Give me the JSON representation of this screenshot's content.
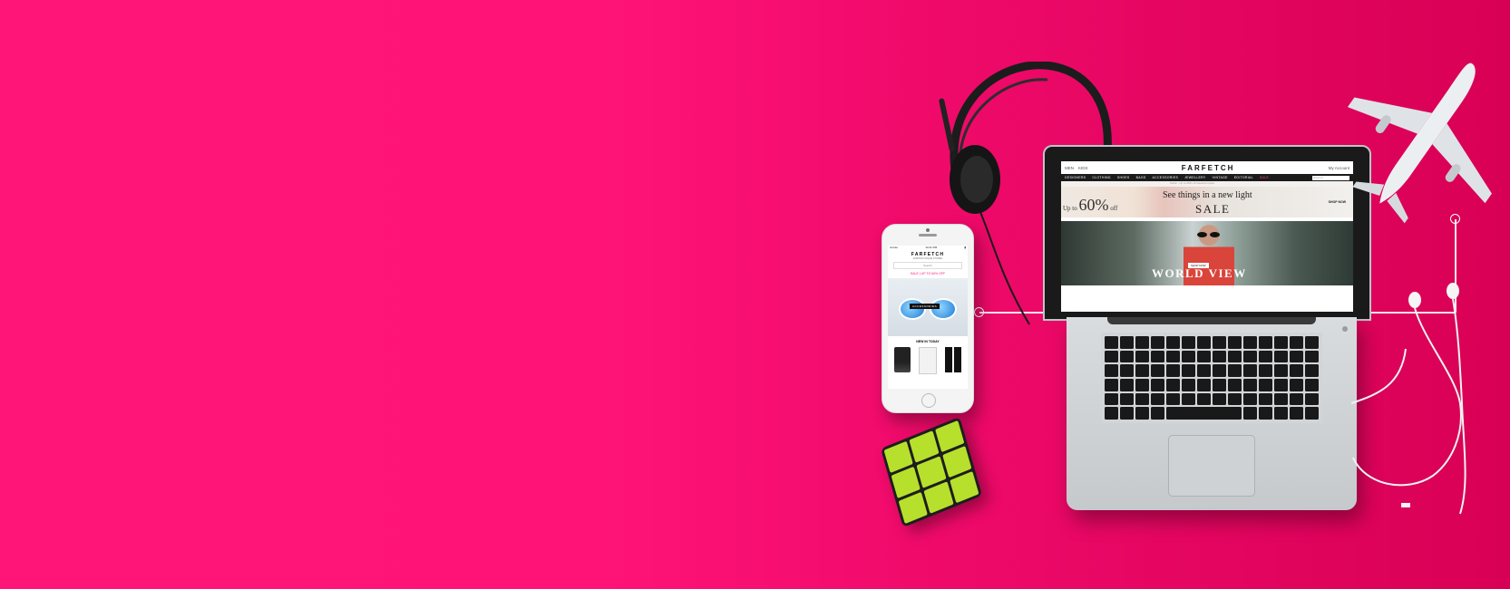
{
  "colors": {
    "bg_left": "#ff1478",
    "bg_right": "#d80055",
    "cube_green": "#b7e02c",
    "sale_pink": "#ff1478"
  },
  "phone": {
    "status_left": "Carrier",
    "status_time": "10:41 PM",
    "brand": "FARFETCH",
    "tagline": "FASHION UNIQUE STORES",
    "search_placeholder": "Search",
    "sale_text": "SALE | UP TO 60% OFF",
    "hero_tag": "ACCESSORIES",
    "section_title": "NEW IN TODAY"
  },
  "laptop": {
    "top_left": [
      "MEN",
      "KIDS"
    ],
    "brand": "FARFETCH",
    "top_right": "My Account",
    "nav": [
      "DESIGNERS",
      "CLOTHING",
      "SHOES",
      "BAGS",
      "ACCESSORIES",
      "JEWELLERY",
      "VINTAGE",
      "EDITORIAL",
      "SALE"
    ],
    "search_placeholder": "Search",
    "breadcrumb": "SALE  ·  Up to 60% off selected styles",
    "banner_upto": "Up to",
    "banner_percent": "60%",
    "banner_off": "off",
    "banner_line1": "See things in a new light",
    "banner_line2": "SALE",
    "banner_cta": "SHOP NOW",
    "photo_chip": "SHOP NOW",
    "photo_title": "WORLD VIEW"
  }
}
